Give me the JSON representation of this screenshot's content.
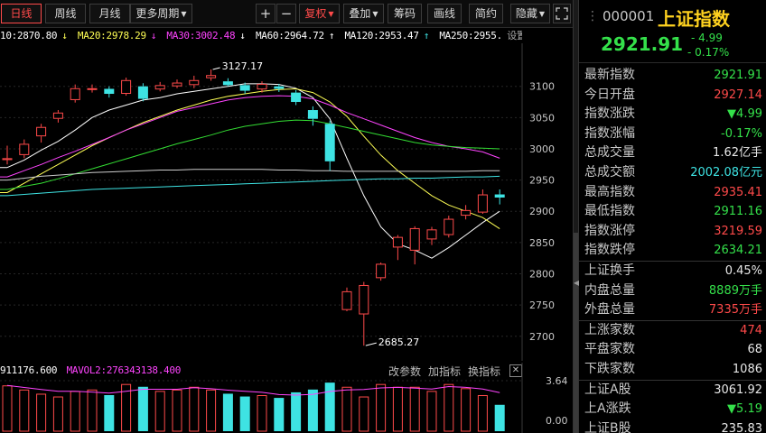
{
  "toolbar": {
    "day": "日线",
    "week": "周线",
    "month": "月线",
    "more": "更多周期",
    "plus": "+",
    "minus": "−",
    "adjust": "复权",
    "overlay": "叠加",
    "chips": "筹码",
    "draw": "画线",
    "simple": "简约",
    "hide": "隐藏"
  },
  "ma_legend": {
    "ma10": "10:2870.80",
    "ma20": "MA20:2978.29",
    "ma30": "MA30:3002.48",
    "ma60": "MA60:2964.72",
    "ma120": "MA120:2953.47",
    "ma250": "MA250:2955.",
    "settings": "设置均线",
    "colors": {
      "ma10": "#ffffff",
      "ma20": "#ffff55",
      "ma30": "#ff44ff",
      "ma60": "#33dd33",
      "ma120": "#cccccc",
      "ma250": "#3ee3e3"
    }
  },
  "volume": {
    "vol_label": "911176.600",
    "mavol2": "MAVOL2:276343138.400",
    "change_params": "改参数",
    "add_indicator": "加指标",
    "replace_indicator": "换指标",
    "close": "✕",
    "axis_top": "3.64",
    "axis_bottom": "0.00"
  },
  "chart_data": {
    "type": "candlestick",
    "yticks": [
      3100,
      3050,
      3000,
      2950,
      2900,
      2850,
      2800,
      2750,
      2700
    ],
    "ylim": [
      2678,
      3140
    ],
    "annotations": {
      "high": "3127.17",
      "low": "2685.27"
    },
    "candles": [
      {
        "o": 2982,
        "c": 2985,
        "h": 3005,
        "l": 2975
      },
      {
        "o": 2990,
        "c": 3008,
        "h": 3015,
        "l": 2985
      },
      {
        "o": 3020,
        "c": 3035,
        "h": 3040,
        "l": 3010
      },
      {
        "o": 3048,
        "c": 3058,
        "h": 3062,
        "l": 3042
      },
      {
        "o": 3078,
        "c": 3097,
        "h": 3103,
        "l": 3074
      },
      {
        "o": 3095,
        "c": 3097,
        "h": 3103,
        "l": 3090
      },
      {
        "o": 3096,
        "c": 3088,
        "h": 3100,
        "l": 3082
      },
      {
        "o": 3088,
        "c": 3110,
        "h": 3114,
        "l": 3085
      },
      {
        "o": 3100,
        "c": 3080,
        "h": 3105,
        "l": 3076
      },
      {
        "o": 3095,
        "c": 3102,
        "h": 3107,
        "l": 3092
      },
      {
        "o": 3100,
        "c": 3106,
        "h": 3111,
        "l": 3097
      },
      {
        "o": 3102,
        "c": 3110,
        "h": 3117,
        "l": 3097
      },
      {
        "o": 3113,
        "c": 3118,
        "h": 3127,
        "l": 3109
      },
      {
        "o": 3108,
        "c": 3102,
        "h": 3113,
        "l": 3100
      },
      {
        "o": 3102,
        "c": 3093,
        "h": 3106,
        "l": 3088
      },
      {
        "o": 3095,
        "c": 3104,
        "h": 3108,
        "l": 3090
      },
      {
        "o": 3100,
        "c": 3096,
        "h": 3104,
        "l": 3091
      },
      {
        "o": 3090,
        "c": 3075,
        "h": 3094,
        "l": 3070
      },
      {
        "o": 3062,
        "c": 3048,
        "h": 3068,
        "l": 3037
      },
      {
        "o": 3040,
        "c": 2980,
        "h": 3045,
        "l": 2965
      },
      {
        "o": 2742,
        "c": 2772,
        "h": 2778,
        "l": 2740
      },
      {
        "o": 2735,
        "c": 2782,
        "h": 2787,
        "l": 2685
      },
      {
        "o": 2793,
        "c": 2816,
        "h": 2818,
        "l": 2789
      },
      {
        "o": 2842,
        "c": 2859,
        "h": 2862,
        "l": 2822
      },
      {
        "o": 2837,
        "c": 2873,
        "h": 2876,
        "l": 2815
      },
      {
        "o": 2855,
        "c": 2871,
        "h": 2875,
        "l": 2846
      },
      {
        "o": 2862,
        "c": 2888,
        "h": 2893,
        "l": 2858
      },
      {
        "o": 2893,
        "c": 2902,
        "h": 2910,
        "l": 2887
      },
      {
        "o": 2898,
        "c": 2927,
        "h": 2935,
        "l": 2896
      },
      {
        "o": 2927,
        "c": 2922,
        "h": 2935,
        "l": 2911
      }
    ],
    "ma_lines": {
      "ma10": [
        2970,
        2982,
        2998,
        3012,
        3030,
        3050,
        3062,
        3070,
        3078,
        3082,
        3088,
        3092,
        3096,
        3100,
        3104,
        3104,
        3103,
        3097,
        3082,
        3048,
        2985,
        2925,
        2875,
        2848,
        2838,
        2825,
        2842,
        2862,
        2882,
        2900
      ],
      "ma20": [
        2930,
        2945,
        2960,
        2975,
        2990,
        3005,
        3018,
        3030,
        3042,
        3052,
        3062,
        3070,
        3078,
        3084,
        3088,
        3092,
        3095,
        3096,
        3090,
        3075,
        3052,
        3020,
        2990,
        2965,
        2945,
        2925,
        2910,
        2900,
        2890,
        2872
      ],
      "ma30": [
        2955,
        2965,
        2975,
        2986,
        2996,
        3007,
        3018,
        3030,
        3040,
        3050,
        3060,
        3066,
        3072,
        3078,
        3082,
        3084,
        3085,
        3084,
        3080,
        3070,
        3058,
        3048,
        3038,
        3028,
        3018,
        3010,
        3004,
        3000,
        2995,
        2985
      ],
      "ma60": [
        2935,
        2940,
        2945,
        2952,
        2960,
        2968,
        2976,
        2984,
        2992,
        3000,
        3008,
        3015,
        3022,
        3030,
        3036,
        3040,
        3044,
        3046,
        3045,
        3040,
        3034,
        3028,
        3022,
        3016,
        3010,
        3006,
        3004,
        3002,
        3001,
        3000
      ],
      "ma120": [
        2950,
        2953,
        2956,
        2958,
        2960,
        2962,
        2963,
        2964,
        2965,
        2966,
        2966,
        2967,
        2967,
        2967,
        2967,
        2967,
        2966,
        2966,
        2965,
        2965,
        2964,
        2964,
        2964,
        2964,
        2964,
        2964,
        2964,
        2964,
        2965,
        2965
      ],
      "ma250": [
        2925,
        2927,
        2929,
        2931,
        2933,
        2935,
        2936,
        2937,
        2938,
        2939,
        2940,
        2941,
        2942,
        2943,
        2944,
        2945,
        2946,
        2947,
        2948,
        2949,
        2950,
        2951,
        2952,
        2952,
        2953,
        2953,
        2954,
        2955,
        2955,
        2956
      ]
    },
    "volume_values": [
      3.3,
      3.0,
      2.7,
      2.5,
      2.9,
      3.0,
      2.6,
      3.4,
      3.2,
      2.9,
      3.0,
      3.2,
      3.0,
      2.7,
      2.5,
      2.6,
      2.4,
      2.8,
      3.0,
      3.5,
      3.2,
      2.5,
      3.4,
      3.2,
      3.2,
      2.9,
      3.4,
      3.1,
      2.6,
      1.9
    ],
    "volume_ylim": [
      0,
      3.64
    ]
  },
  "panel": {
    "code": "000001",
    "name": "上证指数",
    "price": "2921.91",
    "change": "- 4.99",
    "change_pct": "- 0.17%",
    "rows": [
      {
        "label": "最新指数",
        "value": "2921.91",
        "color": "g"
      },
      {
        "label": "今日开盘",
        "value": "2927.14",
        "color": "r"
      },
      {
        "label": "指数涨跌",
        "value": "▼4.99",
        "color": "g"
      },
      {
        "label": "指数涨幅",
        "value": "-0.17%",
        "color": "g"
      },
      {
        "label": "总成交量",
        "value": "1.62亿手",
        "color": "w"
      },
      {
        "label": "总成交额",
        "value": "2002.08亿元",
        "color": "c"
      },
      {
        "label": "最高指数",
        "value": "2935.41",
        "color": "r"
      },
      {
        "label": "最低指数",
        "value": "2911.16",
        "color": "g"
      },
      {
        "label": "指数涨停",
        "value": "3219.59",
        "color": "r"
      },
      {
        "label": "指数跌停",
        "value": "2634.21",
        "color": "g"
      },
      {
        "label": "上证换手",
        "value": "0.45%",
        "color": "w"
      },
      {
        "label": "内盘总量",
        "value": "8889万手",
        "color": "g"
      },
      {
        "label": "外盘总量",
        "value": "7335万手",
        "color": "r"
      },
      {
        "label": "上涨家数",
        "value": "474",
        "color": "r"
      },
      {
        "label": "平盘家数",
        "value": "68",
        "color": "w"
      },
      {
        "label": "下跌家数",
        "value": "1086",
        "color": "w"
      },
      {
        "label": "上证A股",
        "value": "3061.92",
        "color": "w"
      },
      {
        "label": "上A涨跌",
        "value": "▼5.19",
        "color": "g"
      },
      {
        "label": "上证B股",
        "value": "235.83",
        "color": "w"
      }
    ]
  }
}
